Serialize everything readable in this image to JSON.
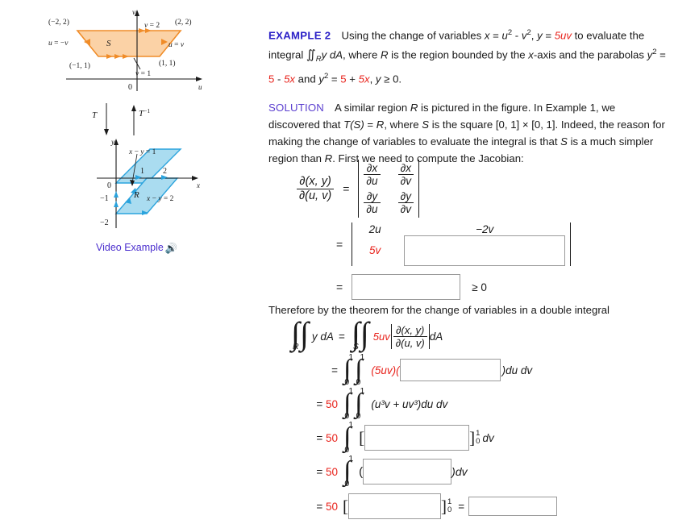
{
  "figures": {
    "uv_figure": {
      "name": "uv-plane-region-S",
      "axis_v": "v",
      "axis_u": "u",
      "origin": "0",
      "region_label": "S",
      "labels": [
        {
          "text": "(−2, 2)",
          "role": "vertex-top-left"
        },
        {
          "text": "(2, 2)",
          "role": "vertex-top-right"
        },
        {
          "text": "(−1, 1)",
          "role": "vertex-bottom-left"
        },
        {
          "text": "(1, 1)",
          "role": "vertex-bottom-right"
        },
        {
          "text": "v = 2",
          "role": "top-edge"
        },
        {
          "text": "v = 1",
          "role": "bottom-edge"
        },
        {
          "text": "u = −v",
          "role": "left-edge"
        },
        {
          "text": "u = v",
          "role": "right-edge"
        }
      ],
      "fill_color": "#fbd2a6",
      "stroke_color": "#f08c28"
    },
    "xy_figure": {
      "name": "xy-plane-region-R",
      "axis_y": "y",
      "axis_x": "x",
      "origin": "0",
      "region_label": "R",
      "tick_labels": [
        "1",
        "2",
        "−1",
        "−2"
      ],
      "labels": [
        {
          "text": "x − y = 1",
          "role": "upper-line"
        },
        {
          "text": "x − y = 2",
          "role": "lower-line"
        }
      ],
      "fill_color": "#aadcf0",
      "stroke_color": "#2aa3dd"
    },
    "transform_arrows": {
      "forward": "T",
      "inverse": "T⁻¹"
    },
    "video_example": {
      "label": "Video Example",
      "icon": "speaker-icon"
    }
  },
  "content": {
    "example": {
      "tag": "EXAMPLE 2",
      "line1_a": "Using the change of variables ",
      "x_eq": "x",
      "eq": " = ",
      "u2": "u",
      "minus": " - ",
      "v2": "v",
      "comma": ", ",
      "y_sym": "y",
      "five_uv": "5uv",
      "line1_b": " to evaluate the",
      "line2_a": "integral ",
      "dblint": "∬",
      "sub_R": "R",
      "ydA": "y dA",
      "line2_b": ", where ",
      "R": "R",
      "line2_c": " is the region bounded by the ",
      "xaxis": "x",
      "line2_d": "-axis and the parabolas ",
      "y_par": "y",
      "line3_a": " = ",
      "five": "5",
      "minus2": " - ",
      "five_x": "5x",
      "line3_b": " and ",
      "y2b": "y",
      "line3_c": " = ",
      "five_b": "5",
      "plus": " + ",
      "five_x_b": "5x",
      "line3_d": ", ",
      "y_final": "y",
      "geq0": " ≥ 0."
    },
    "solution": {
      "tag": "SOLUTION",
      "text_a": "A similar region ",
      "R1": "R",
      "text_b": " is pictured in the figure. In Example 1, we discovered that ",
      "TS": "T(S)",
      "text_c": " = ",
      "R2": "R",
      "text_d": ", where ",
      "S1": "S",
      "text_e": " is the square [0, 1] × [0, 1]. Indeed, the reason for making the change of variables to evaluate the integral is that ",
      "S2": "S",
      "text_f": " is a much simpler region than ",
      "R3": "R",
      "text_g": ". First we need to compute the Jacobian:"
    },
    "jacobian": {
      "lhs_num": "∂(x, y)",
      "lhs_den": "∂(u, v)",
      "equals": "=",
      "m11_num": "∂x",
      "m11_den": "∂u",
      "m12_num": "∂x",
      "m12_den": "∂v",
      "m21_num": "∂y",
      "m21_den": "∂u",
      "m22_num": "∂y",
      "m22_den": "∂v",
      "row2_a": "2u",
      "row2_b": "−2v",
      "row2_c": "5v",
      "row2_d_answer": "",
      "row3_answer": "",
      "row3_suffix": "≥ 0"
    },
    "therefore_text": "Therefore by the theorem for the change of variables in a double integral",
    "integral_block": {
      "lhs_int": "∫∫",
      "lhs_sub": "R",
      "lhs_body": "y dA",
      "eq1": "=",
      "rhs_int": "∫∫",
      "rhs_sub": "S",
      "five_uv": "5uv",
      "abs_num": "∂(x, y)",
      "abs_den": "∂(u, v)",
      "dA": "dA",
      "lines": [
        {
          "lead": "=",
          "coef": "",
          "upper": "1",
          "lower": "0",
          "upper2": "1",
          "lower2": "0",
          "pre": "(5uv)(",
          "box": "",
          "post": ")du dv",
          "box_class": "b-line1"
        },
        {
          "lead": "= ",
          "coef": "50",
          "upper": "1",
          "lower": "0",
          "upper2": "1",
          "lower2": "0",
          "pre": "",
          "body": "(u³v + uv³)du dv",
          "filled": true
        },
        {
          "lead": "= ",
          "coef": "50",
          "upper": "1",
          "lower": "0",
          "pre": "[",
          "box": "",
          "post": "dv",
          "eval_up": "1",
          "eval_lo": "0",
          "box_class": "b-line2"
        },
        {
          "lead": "= ",
          "coef": "50",
          "upper": "1",
          "lower": "0",
          "pre": "(",
          "box": "",
          "post": ")dv",
          "box_class": "b-line3"
        },
        {
          "lead": "= ",
          "coef": "50",
          "pre": "[",
          "box": "",
          "eval_up": "1",
          "eval_lo": "0",
          "mid_eq": "=",
          "box2": "",
          "box_class": "b-line4"
        }
      ]
    }
  },
  "colors": {
    "heading_blue": "#2b20c7",
    "solution_purple": "#5b3fcf",
    "accent_red": "#e8231c",
    "link_purple": "#4b2fce",
    "region_s_fill": "#fbd2a6",
    "region_r_fill": "#aadcf0"
  }
}
